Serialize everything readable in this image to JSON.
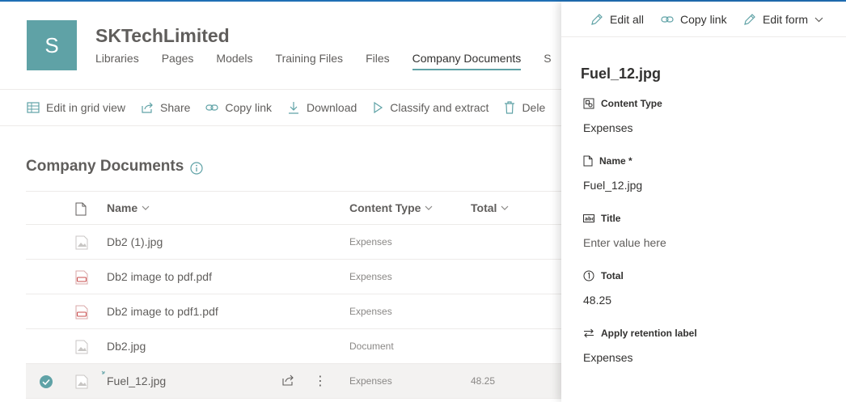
{
  "site": {
    "logo_letter": "S",
    "title": "SKTechLimited",
    "nav": [
      "Libraries",
      "Pages",
      "Models",
      "Training Files",
      "Files",
      "Company Documents",
      "S"
    ]
  },
  "commands": {
    "edit_grid": "Edit in grid view",
    "share": "Share",
    "copy_link": "Copy link",
    "download": "Download",
    "classify": "Classify and extract",
    "delete": "Dele"
  },
  "list": {
    "title": "Company Documents",
    "columns": {
      "name": "Name",
      "content_type": "Content Type",
      "total": "Total"
    },
    "rows": [
      {
        "name": "Db2 (1).jpg",
        "content_type": "Expenses",
        "total": "",
        "icon": "image-file-icon"
      },
      {
        "name": "Db2 image to pdf.pdf",
        "content_type": "Expenses",
        "total": "",
        "icon": "pdf-file-icon"
      },
      {
        "name": "Db2 image to pdf1.pdf",
        "content_type": "Expenses",
        "total": "",
        "icon": "pdf-file-icon"
      },
      {
        "name": "Db2.jpg",
        "content_type": "Document",
        "total": "",
        "icon": "image-file-icon"
      },
      {
        "name": "Fuel_12.jpg",
        "content_type": "Expenses",
        "total": "48.25",
        "icon": "image-file-icon",
        "selected": true
      }
    ]
  },
  "pane": {
    "edit_all": "Edit all",
    "copy_link": "Copy link",
    "edit_form": "Edit form",
    "title": "Fuel_12.jpg",
    "fields": {
      "content_type": {
        "label": "Content Type",
        "value": "Expenses"
      },
      "name": {
        "label": "Name *",
        "value": "Fuel_12.jpg"
      },
      "title": {
        "label": "Title",
        "placeholder": "Enter value here"
      },
      "total": {
        "label": "Total",
        "value": "48.25"
      },
      "retention": {
        "label": "Apply retention label",
        "value": "Expenses"
      }
    }
  },
  "colors": {
    "accent": "#5fa2a6",
    "top_line": "#1f6fb5",
    "text": "#323130",
    "muted": "#605e5c"
  }
}
